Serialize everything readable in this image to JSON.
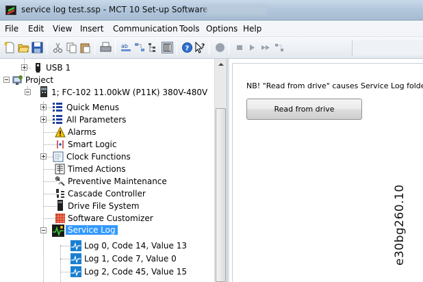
{
  "window": {
    "title": "service log test.ssp - MCT 10 Set-up Software"
  },
  "menu": [
    "File",
    "Edit",
    "View",
    "Insert",
    "Communication",
    "Tools",
    "Options",
    "Help"
  ],
  "toolbar": {
    "icons": [
      "new-icon",
      "open-icon",
      "save-icon",
      "cut-icon",
      "copy-icon",
      "paste-icon",
      "print-icon",
      "ab-rename-icon",
      "move-icon",
      "tree-icon",
      "grid-view-icon",
      "help-icon",
      "context-help-icon",
      "record-icon",
      "stop-icon",
      "play-icon",
      "forward-icon",
      "connect-icon"
    ]
  },
  "tree": {
    "usb": "USB 1",
    "project": "Project",
    "drive": "1; FC-102 11.00kW (P11K) 380V-480V",
    "items": [
      {
        "label": "Quick Menus",
        "icon": "quick-menus-icon",
        "expander": "plus"
      },
      {
        "label": "All Parameters",
        "icon": "all-parameters-icon",
        "expander": "plus"
      },
      {
        "label": "Alarms",
        "icon": "alarm-warning-icon",
        "expander": "none"
      },
      {
        "label": "Smart Logic",
        "icon": "smart-logic-icon",
        "expander": "none"
      },
      {
        "label": "Clock Functions",
        "icon": "clock-functions-icon",
        "expander": "plus"
      },
      {
        "label": "Timed Actions",
        "icon": "timed-actions-icon",
        "expander": "none"
      },
      {
        "label": "Preventive Maintenance",
        "icon": "wrench-icon",
        "expander": "none"
      },
      {
        "label": "Cascade Controller",
        "icon": "cascade-controller-icon",
        "expander": "none"
      },
      {
        "label": "Drive File System",
        "icon": "drive-file-system-icon",
        "expander": "none"
      },
      {
        "label": "Software Customizer",
        "icon": "software-customizer-icon",
        "expander": "none"
      },
      {
        "label": "Service Log",
        "icon": "service-log-icon",
        "expander": "minus",
        "selected": true
      }
    ],
    "logs": [
      "Log 0, Code 14, Value 13",
      "Log 1, Code 7, Value 0",
      "Log 2, Code 45, Value 15"
    ]
  },
  "content": {
    "note": "NB! \"Read from drive\" causes Service Log folder con",
    "read_button": "Read from drive"
  },
  "figure_id": "e30bg260.10",
  "colors": {
    "selection": "#3399ff",
    "log_icon": "#1a7fd0",
    "alarm": "#f2c200"
  }
}
